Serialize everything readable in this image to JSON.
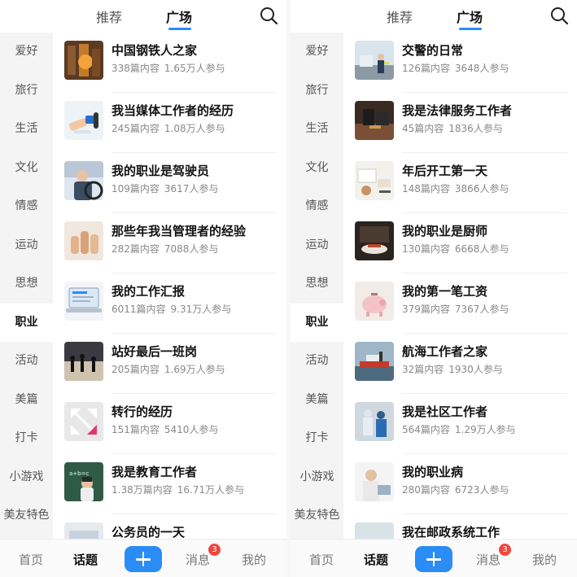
{
  "header": {
    "tabs": [
      "推荐",
      "广场"
    ]
  },
  "sidebar": [
    "爱好",
    "旅行",
    "生活",
    "文化",
    "情感",
    "运动",
    "思想",
    "职业",
    "活动",
    "美篇",
    "打卡",
    "小游戏",
    "美友特色"
  ],
  "sidebar_active": "职业",
  "left_list": [
    {
      "title": "中国钢铁人之家",
      "posts": "338篇内容",
      "people": "1.65万人参与",
      "icon": "steel-mill-thumbnail"
    },
    {
      "title": "我当媒体工作者的经历",
      "posts": "245篇内容",
      "people": "1.08万人参与",
      "icon": "microphone-thumbnail"
    },
    {
      "title": "我的职业是驾驶员",
      "posts": "109篇内容",
      "people": "3617人参与",
      "icon": "driver-thumbnail"
    },
    {
      "title": "那些年我当管理者的经验",
      "posts": "282篇内容",
      "people": "7088人参与",
      "icon": "thumbs-up-thumbnail"
    },
    {
      "title": "我的工作汇报",
      "posts": "6011篇内容",
      "people": "9.31万人参与",
      "icon": "laptop-thumbnail"
    },
    {
      "title": "站好最后一班岗",
      "posts": "205篇内容",
      "people": "1.69万人参与",
      "icon": "silhouettes-thumbnail"
    },
    {
      "title": "转行的经历",
      "posts": "151篇内容",
      "people": "5410人参与",
      "icon": "arrows-thumbnail"
    },
    {
      "title": "我是教育工作者",
      "posts": "1.38万篇内容",
      "people": "16.71万人参与",
      "icon": "teacher-thumbnail"
    },
    {
      "title": "公务员的一天",
      "posts": "",
      "people": "",
      "icon": "office-thumbnail"
    }
  ],
  "right_list": [
    {
      "title": "交警的日常",
      "posts": "126篇内容",
      "people": "3648人参与",
      "icon": "traffic-police-thumbnail"
    },
    {
      "title": "我是法律服务工作者",
      "posts": "45篇内容",
      "people": "1836人参与",
      "icon": "lawyer-thumbnail"
    },
    {
      "title": "年后开工第一天",
      "posts": "148篇内容",
      "people": "3866人参与",
      "icon": "desk-thumbnail"
    },
    {
      "title": "我的职业是厨师",
      "posts": "130篇内容",
      "people": "6668人参与",
      "icon": "chef-thumbnail"
    },
    {
      "title": "我的第一笔工资",
      "posts": "379篇内容",
      "people": "7367人参与",
      "icon": "piggy-bank-thumbnail"
    },
    {
      "title": "航海工作者之家",
      "posts": "32篇内容",
      "people": "1930人参与",
      "icon": "ship-thumbnail"
    },
    {
      "title": "我是社区工作者",
      "posts": "564篇内容",
      "people": "1.29万人参与",
      "icon": "community-worker-thumbnail"
    },
    {
      "title": "我的职业病",
      "posts": "280篇内容",
      "people": "6723人参与",
      "icon": "neck-pain-thumbnail"
    },
    {
      "title": "我在邮政系统工作",
      "posts": "",
      "people": "",
      "icon": "post-office-thumbnail"
    }
  ],
  "bottom_nav": {
    "home": "首页",
    "topics": "话题",
    "messages": "消息",
    "messages_badge": "3",
    "mine": "我的"
  },
  "colors": {
    "accent": "#2a8cf5",
    "badge": "#f0463e"
  }
}
